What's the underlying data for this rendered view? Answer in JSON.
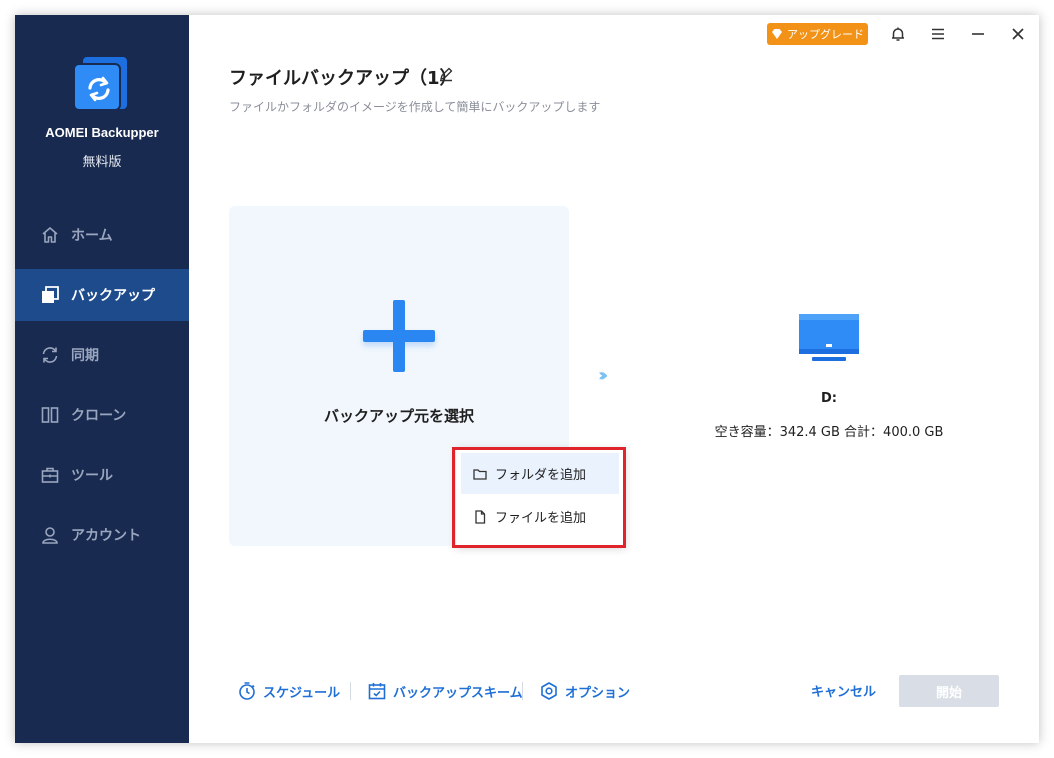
{
  "app": {
    "name": "AOMEI Backupper",
    "edition": "無料版",
    "upgrade_label": "アップグレード"
  },
  "sidebar": {
    "items": [
      {
        "label": "ホーム",
        "icon": "home-icon",
        "active": false
      },
      {
        "label": "バックアップ",
        "icon": "backup-icon",
        "active": true
      },
      {
        "label": "同期",
        "icon": "sync-icon",
        "active": false
      },
      {
        "label": "クローン",
        "icon": "clone-icon",
        "active": false
      },
      {
        "label": "ツール",
        "icon": "tools-icon",
        "active": false
      },
      {
        "label": "アカウント",
        "icon": "account-icon",
        "active": false
      }
    ]
  },
  "main": {
    "title": "ファイルバックアップ（1）",
    "subtitle": "ファイルかフォルダのイメージを作成して簡単にバックアップします",
    "source_label": "バックアップ元を選択",
    "destination": {
      "drive": "D:",
      "capacity": "空き容量：342.4 GB 合計：400.0 GB"
    },
    "popup": {
      "add_folder": "フォルダを追加",
      "add_file": "ファイルを追加"
    }
  },
  "footer": {
    "schedule": "スケジュール",
    "scheme": "バックアップスキーム",
    "options": "オプション",
    "cancel": "キャンセル",
    "start": "開始"
  },
  "colors": {
    "sidebar_bg": "#182a4f",
    "active_bg": "#1e4b8c",
    "accent": "#2a86f0",
    "upgrade": "#f29217",
    "highlight": "#e0242c"
  }
}
